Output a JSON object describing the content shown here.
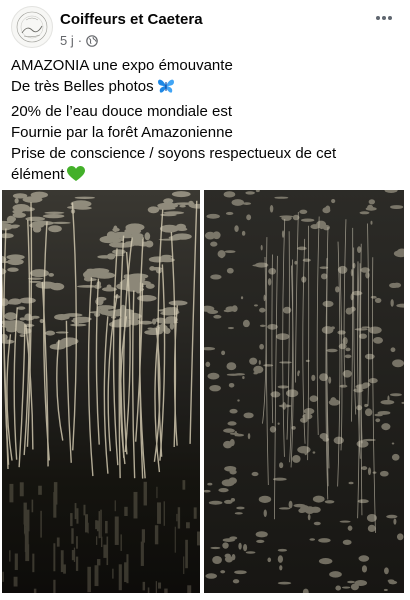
{
  "post": {
    "author": "Coiffeurs et Caetera",
    "timestamp": "5 j",
    "separator": "·",
    "privacy_icon": "globe-icon",
    "more_icon": "more-options-icon",
    "caption_lines": [
      "AMAZONIA une expo émouvante",
      "De très Belles photos",
      "20% de l’eau douce mondiale est",
      "Fournie par la forêt Amazonienne",
      "Prise de conscience / soyons respectueux de cet",
      "élément"
    ],
    "caption_emojis": {
      "line2": "butterfly-emoji",
      "line6": "green-heart-emoji"
    },
    "photos": [
      {
        "description_icon": "papyrus-forest-photo"
      },
      {
        "description_icon": "jungle-canopy-photo"
      }
    ]
  },
  "colors": {
    "text": "#050505",
    "secondary_text": "#65676b",
    "butterfly": "#1e88e5",
    "heart": "#43b02a"
  }
}
